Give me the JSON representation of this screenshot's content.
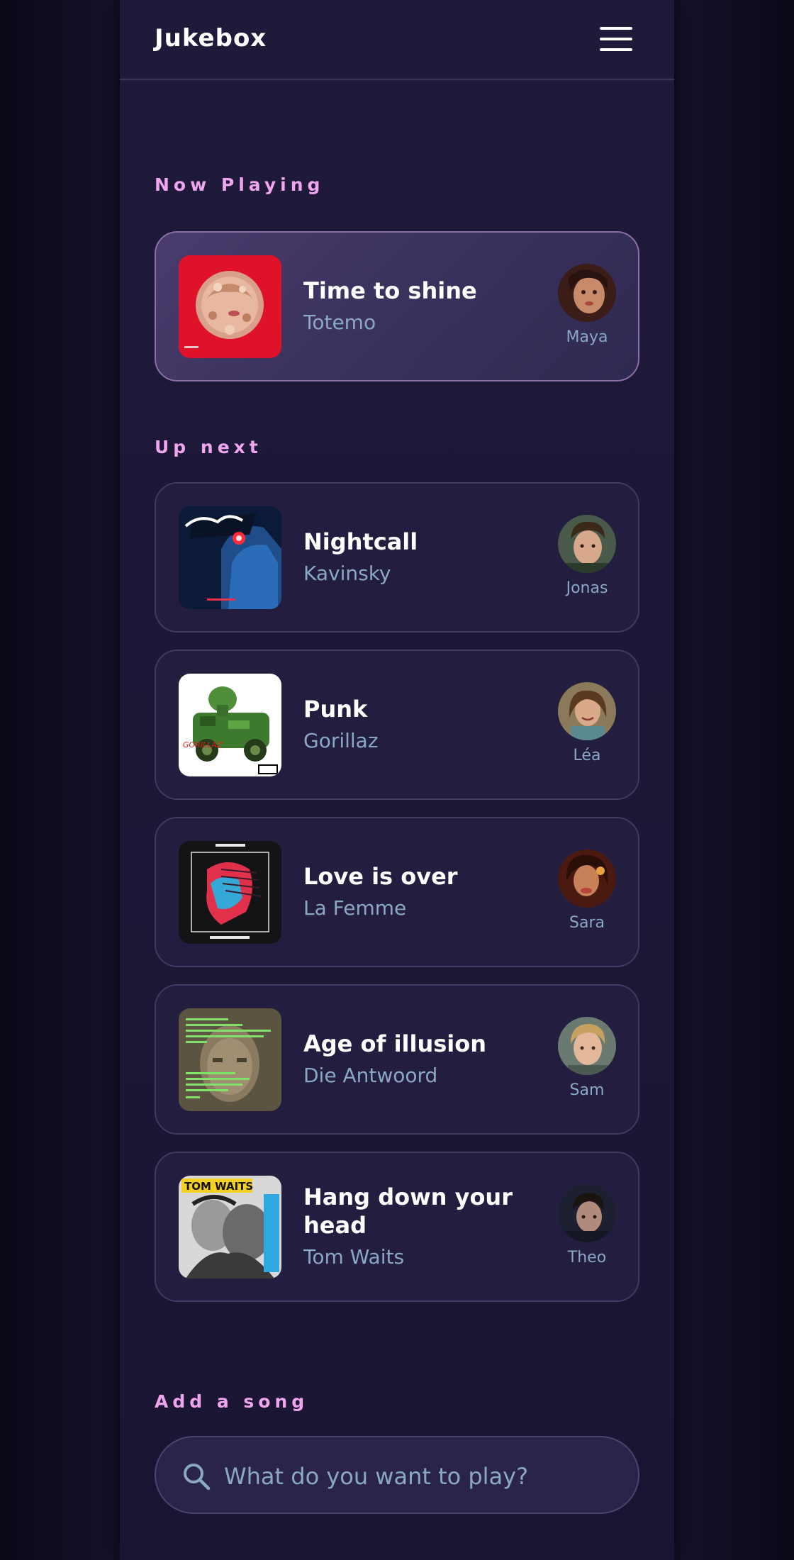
{
  "app": {
    "title": "Jukebox"
  },
  "now_playing": {
    "heading": "Now Playing",
    "track": {
      "title": "Time to shine",
      "artist": "Totemo",
      "requested_by": "Maya"
    }
  },
  "up_next": {
    "heading": "Up next",
    "tracks": [
      {
        "title": "Nightcall",
        "artist": "Kavinsky",
        "requested_by": "Jonas"
      },
      {
        "title": "Punk",
        "artist": "Gorillaz",
        "requested_by": "Léa"
      },
      {
        "title": "Love is over",
        "artist": "La Femme",
        "requested_by": "Sara"
      },
      {
        "title": "Age of illusion",
        "artist": "Die Antwoord",
        "requested_by": "Sam"
      },
      {
        "title": "Hang down your head",
        "artist": "Tom Waits",
        "requested_by": "Theo"
      }
    ]
  },
  "add_song": {
    "heading": "Add a song",
    "placeholder": "What do you want to play?"
  },
  "colors": {
    "accent_heading": "#f0a6ee",
    "muted_text": "#8aa7c4",
    "card_bg": "#231e3f",
    "app_bg": "#1d1837"
  }
}
